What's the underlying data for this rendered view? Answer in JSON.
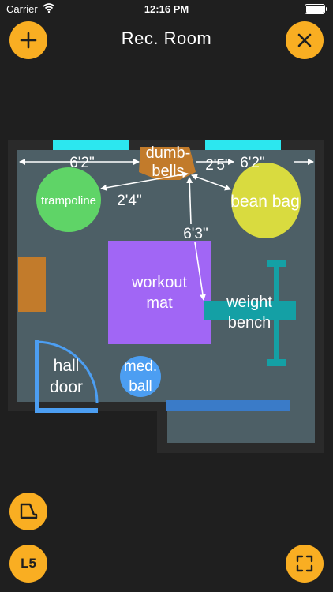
{
  "status_bar": {
    "carrier": "Carrier",
    "time": "12:16 PM"
  },
  "header": {
    "title": "Rec. Room"
  },
  "buttons": {
    "level_label": "L5"
  },
  "furniture": {
    "dumbbells": [
      "dumb-",
      "bells"
    ],
    "trampoline": "trampoline",
    "bean_bag": "bean bag",
    "workout_mat": [
      "workout",
      "mat"
    ],
    "weight_bench": [
      "weight",
      "bench"
    ],
    "hall_door": [
      "hall",
      "door"
    ],
    "med_ball": [
      "med.",
      "ball"
    ]
  },
  "dimensions": {
    "left_wall_to_dumbbells": "6'2\"",
    "dumbbells_to_bean_bag": "2'5\"",
    "bean_bag_to_right_wall": "6'2\"",
    "trampoline_to_dumbbells": "2'4\"",
    "dumbbells_to_bench": "6'3\""
  },
  "colors": {
    "accent": "#f9ae22",
    "room_floor": "#4d5f66",
    "wall": "#2a2a2a",
    "trampoline": "#5fd467",
    "bean_bag": "#d9db3f",
    "workout_mat": "#a166f5",
    "weight_bench": "#14a0a5",
    "dumbbells": "#c27b2b",
    "med_ball": "#4c9ef2",
    "door": "#4c9ef2",
    "window": "#2ce7ef"
  }
}
